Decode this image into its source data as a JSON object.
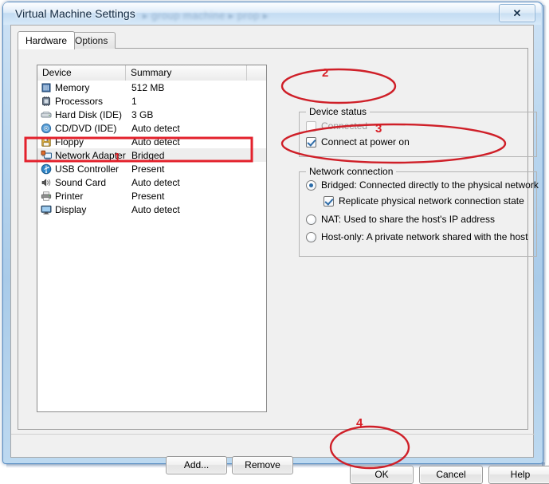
{
  "window": {
    "title": "Virtual Machine Settings",
    "title_blurred_suffix": "▸ group machine ▸ prop ▸",
    "close_icon_glyph": "✕",
    "frame_color": "#5b8fc4"
  },
  "tabs": [
    {
      "label": "Hardware",
      "selected": true
    },
    {
      "label": "Options",
      "selected": false
    }
  ],
  "device_list": {
    "columns": [
      "Device",
      "Summary"
    ],
    "rows": [
      {
        "device": "Memory",
        "summary": "512 MB",
        "icon": "memory-icon",
        "selected": false
      },
      {
        "device": "Processors",
        "summary": "1",
        "icon": "processor-icon",
        "selected": false
      },
      {
        "device": "Hard Disk (IDE)",
        "summary": "3 GB",
        "icon": "harddisk-icon",
        "selected": false
      },
      {
        "device": "CD/DVD (IDE)",
        "summary": "Auto detect",
        "icon": "cddvd-icon",
        "selected": false
      },
      {
        "device": "Floppy",
        "summary": "Auto detect",
        "icon": "floppy-icon",
        "selected": false
      },
      {
        "device": "Network Adapter",
        "summary": "Bridged",
        "icon": "network-icon",
        "selected": true
      },
      {
        "device": "USB Controller",
        "summary": "Present",
        "icon": "usb-icon",
        "selected": false
      },
      {
        "device": "Sound Card",
        "summary": "Auto detect",
        "icon": "soundcard-icon",
        "selected": false
      },
      {
        "device": "Printer",
        "summary": "Present",
        "icon": "printer-icon",
        "selected": false
      },
      {
        "device": "Display",
        "summary": "Auto detect",
        "icon": "display-icon",
        "selected": false
      }
    ],
    "add_label": "Add...",
    "remove_label": "Remove"
  },
  "device_status": {
    "group_title": "Device status",
    "connected": {
      "label": "Connected",
      "checked": false,
      "disabled": true
    },
    "connect_at_power_on": {
      "label": "Connect at power on",
      "checked": true,
      "disabled": false
    }
  },
  "network_connection": {
    "group_title": "Network connection",
    "options": [
      {
        "label": "Bridged: Connected directly to the physical network",
        "selected": true
      },
      {
        "label": "NAT: Used to share the host's IP address",
        "selected": false
      },
      {
        "label": "Host-only: A private network shared with the host",
        "selected": false
      }
    ],
    "replicate": {
      "label": "Replicate physical network connection state",
      "checked": true
    }
  },
  "dialog_buttons": {
    "ok": "OK",
    "cancel": "Cancel",
    "help": "Help"
  },
  "annotations": {
    "color": "#d81f26",
    "markers": [
      {
        "number": "1",
        "shape": "rectangle",
        "target": "network-adapter-row"
      },
      {
        "number": "2",
        "shape": "ellipse",
        "target": "device-status-checkboxes"
      },
      {
        "number": "3",
        "shape": "ellipse",
        "target": "bridged-option-and-replicate"
      },
      {
        "number": "4",
        "shape": "ellipse",
        "target": "ok-button"
      }
    ]
  }
}
